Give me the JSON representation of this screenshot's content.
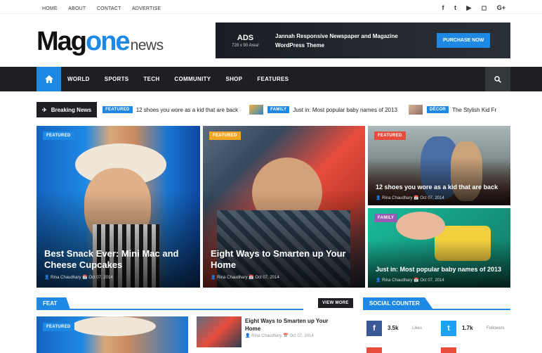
{
  "topnav": {
    "links": [
      "HOME",
      "ABOUT",
      "CONTACT",
      "ADVERTISE"
    ]
  },
  "social_top": [
    "f",
    "t",
    "▶",
    "◻",
    "G+"
  ],
  "logo": {
    "part1": "Mag",
    "part2": "one",
    "part3": "news"
  },
  "ad": {
    "title": "ADS",
    "size": "728 x 90 Area!",
    "text": "Jannah Responsive Newspaper and Magazine WordPress Theme",
    "button": "PURCHASE NOW"
  },
  "nav": {
    "items": [
      "WORLD",
      "SPORTS",
      "TECH",
      "COMMUNITY",
      "SHOP",
      "FEATURES"
    ]
  },
  "breaking": {
    "label": "Breaking News",
    "items": [
      {
        "tag": "FEATURED",
        "text": "12 shoes you wore as a kid that are back"
      },
      {
        "tag": "FAMILY",
        "text": "Just in: Most popular baby names of 2013"
      },
      {
        "tag": "DÉCOR",
        "text": "The Stylish Kid Fr"
      }
    ]
  },
  "cards": [
    {
      "tag": "FEATURED",
      "tag_color": "#1e88e5",
      "title": "Best Snack Ever: Mini Mac and Cheese Cupcakes",
      "author": "Rina Chaudhary",
      "date": "Oct 07, 2014"
    },
    {
      "tag": "FEATURED",
      "tag_color": "#f5a623",
      "title": "Eight Ways to Smarten up Your Home",
      "author": "Rina Chaudhary",
      "date": "Oct 07, 2014"
    },
    {
      "tag": "FEATURED",
      "tag_color": "#e74c3c",
      "title": "12 shoes you wore as a kid that are back",
      "author": "Rina Chaudhary",
      "date": "Oct 07, 2014"
    },
    {
      "tag": "FAMILY",
      "tag_color": "#9b59b6",
      "title": "Just in: Most popular baby names of 2013",
      "author": "Rina Chaudhary",
      "date": "Oct 07, 2014"
    }
  ],
  "feat": {
    "heading": "FEAT",
    "view_more": "VIEW MORE",
    "thumb_tag": "FEATURED",
    "post_title": "Eight Ways to Smarten up Your Home",
    "post_author": "Rina Chaudhary",
    "post_date": "Oct 07, 2014"
  },
  "social_counter": {
    "heading": "SOCIAL COUNTER",
    "items": [
      {
        "icon": "f",
        "count": "3.5k",
        "label": "Likes",
        "color": "#3b5998"
      },
      {
        "icon": "t",
        "count": "1.7k",
        "label": "Followers",
        "color": "#1da1f2"
      }
    ]
  }
}
